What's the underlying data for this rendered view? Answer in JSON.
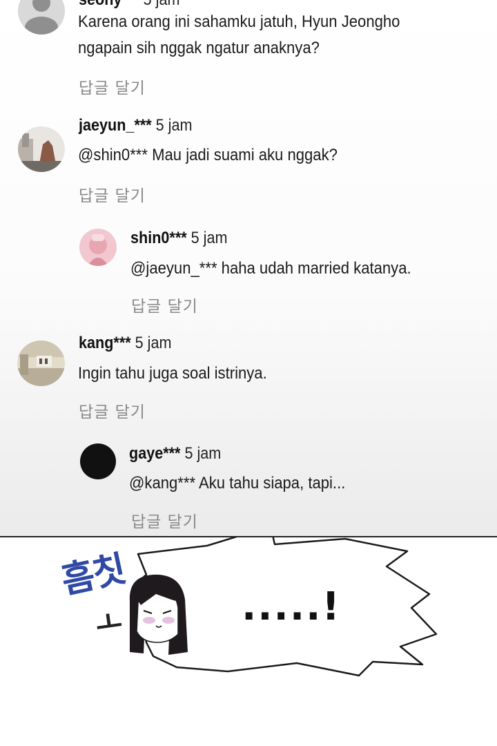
{
  "comments": [
    {
      "id": "c0",
      "username": "seony***",
      "time": "5 jam",
      "lines": [
        "Karena orang ini sahamku jatuh, Hyun Jeongho",
        "ngapain sih nggak ngatur anaknya?"
      ],
      "reply_label": "답글 달기",
      "avatar": "default-user-avatar"
    },
    {
      "id": "c1",
      "username": "jaeyun_***",
      "time": "5 jam",
      "lines": [
        "@shin0*** Mau jadi suami aku nggak?"
      ],
      "reply_label": "답글 달기",
      "avatar": "photo-avatar"
    },
    {
      "id": "c2",
      "username": "shin0***",
      "time": "5 jam",
      "lines": [
        "@jaeyun_*** haha udah married katanya."
      ],
      "reply_label": "답글 달기",
      "avatar": "pink-photo-avatar"
    },
    {
      "id": "c3",
      "username": "kang***",
      "time": "5 jam",
      "lines": [
        "Ingin tahu juga soal istrinya."
      ],
      "reply_label": "답글 달기",
      "avatar": "room-photo-avatar"
    },
    {
      "id": "c4",
      "username": "gaye***",
      "time": "5 jam",
      "lines": [
        "@kang*** Aku tahu siapa, tapi..."
      ],
      "reply_label": "답글 달기",
      "avatar": "black-circle-avatar"
    }
  ],
  "comic": {
    "sound_effect": "흠칫",
    "sound_effect_tail": "ㅗ",
    "bubble_text": ".....!"
  }
}
